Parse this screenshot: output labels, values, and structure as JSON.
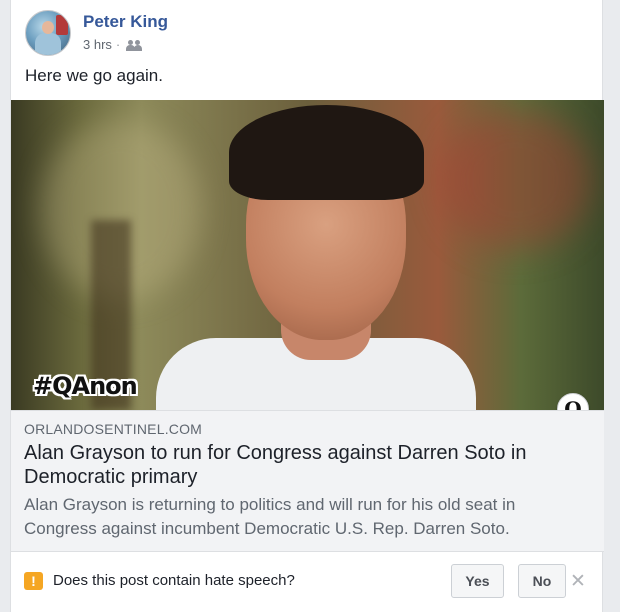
{
  "post": {
    "author": "Peter King",
    "time": "3 hrs",
    "separator": "·",
    "audience_icon": "friends-icon",
    "text": "Here we go again."
  },
  "image": {
    "overlay_tag": "#QAnon",
    "badge": "Q"
  },
  "link": {
    "domain": "ORLANDOSENTINEL.COM",
    "title": "Alan Grayson to run for Congress against Darren Soto in Democratic primary",
    "description": "Alan Grayson is returning to politics and will run for his old seat in Congress against incumbent Democratic U.S. Rep. Darren Soto."
  },
  "survey": {
    "icon": "warning-icon",
    "question": "Does this post contain hate speech?",
    "yes_label": "Yes",
    "no_label": "No",
    "close_glyph": "✕"
  },
  "colors": {
    "author_link": "#365899",
    "warning": "#f5a623",
    "link_box_bg": "#f2f3f5"
  }
}
